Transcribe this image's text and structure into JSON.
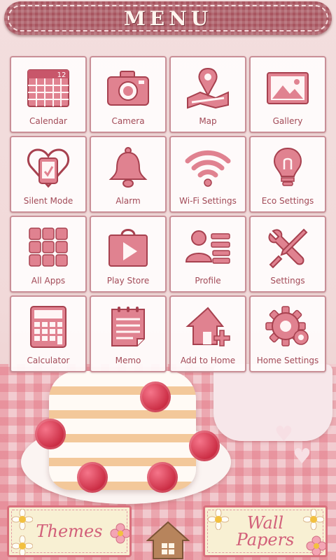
{
  "header": {
    "title": "MENU"
  },
  "apps": [
    {
      "label": "Calendar",
      "icon": "calendar-icon"
    },
    {
      "label": "Camera",
      "icon": "camera-icon"
    },
    {
      "label": "Map",
      "icon": "map-icon"
    },
    {
      "label": "Gallery",
      "icon": "gallery-icon"
    },
    {
      "label": "Silent Mode",
      "icon": "silent-mode-icon"
    },
    {
      "label": "Alarm",
      "icon": "bell-icon"
    },
    {
      "label": "Wi-Fi Settings",
      "icon": "wifi-icon"
    },
    {
      "label": "Eco Settings",
      "icon": "lightbulb-icon"
    },
    {
      "label": "All Apps",
      "icon": "all-apps-grid-icon"
    },
    {
      "label": "Play Store",
      "icon": "play-store-icon"
    },
    {
      "label": "Profile",
      "icon": "profile-icon"
    },
    {
      "label": "Settings",
      "icon": "tools-icon"
    },
    {
      "label": "Calculator",
      "icon": "calculator-icon"
    },
    {
      "label": "Memo",
      "icon": "memo-icon"
    },
    {
      "label": "Add to Home",
      "icon": "add-to-home-icon"
    },
    {
      "label": "Home Settings",
      "icon": "gear-icon"
    }
  ],
  "calendar_day": "12",
  "bottom": {
    "themes_label": "Themes",
    "wallpapers_line1": "Wall",
    "wallpapers_line2": "Papers",
    "home_icon": "home-icon"
  },
  "colors": {
    "icon_pink": "#e08290",
    "icon_stroke": "#a7414f",
    "label": "#a24a57",
    "header": "#a85560"
  }
}
